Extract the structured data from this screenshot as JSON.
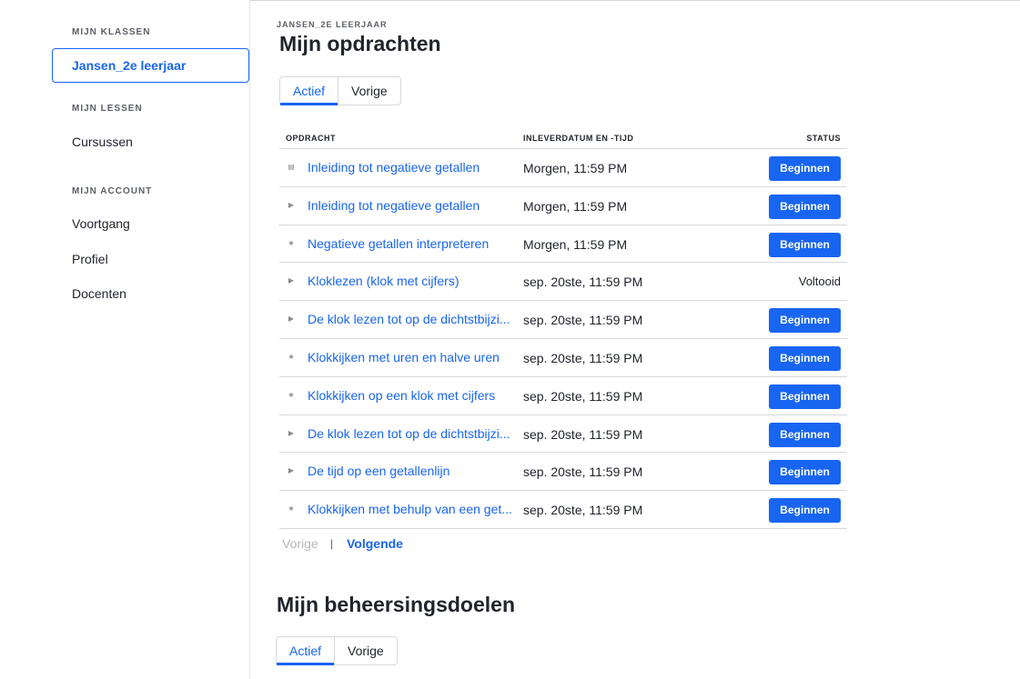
{
  "sidebar": {
    "classes_heading": "MIJN KLASSEN",
    "active_class": "Jansen_2e leerjaar",
    "lessons_heading": "MIJN LESSEN",
    "courses": "Cursussen",
    "account_heading": "MIJN ACCOUNT",
    "progress": "Voortgang",
    "profile": "Profiel",
    "teachers": "Docenten"
  },
  "main": {
    "breadcrumb": "JANSEN_2E LEERJAAR",
    "title": "Mijn opdrachten",
    "tabs": [
      {
        "label": "Actief",
        "active": true
      },
      {
        "label": "Vorige",
        "active": false
      }
    ],
    "columns": {
      "title": "OPDRACHT",
      "date": "INLEVERDATUM EN -TIJD",
      "status": "STATUS"
    },
    "assignments": [
      {
        "icon": "document-icon",
        "title": "Inleiding tot negatieve getallen",
        "date": "Morgen, 11:59 PM",
        "status": "Beginnen"
      },
      {
        "icon": "play-icon",
        "title": "Inleiding tot negatieve getallen",
        "date": "Morgen, 11:59 PM",
        "status": "Beginnen"
      },
      {
        "icon": "star-icon",
        "title": "Negatieve getallen interpreteren",
        "date": "Morgen, 11:59 PM",
        "status": "Beginnen"
      },
      {
        "icon": "play-icon",
        "title": "Kloklezen (klok met cijfers)",
        "date": "sep. 20ste, 11:59 PM",
        "status": "Voltooid"
      },
      {
        "icon": "play-icon",
        "title": "De klok lezen tot op de dichtstbijzi...",
        "date": "sep. 20ste, 11:59 PM",
        "status": "Beginnen"
      },
      {
        "icon": "star-icon",
        "title": "Klokkijken met uren en halve uren",
        "date": "sep. 20ste, 11:59 PM",
        "status": "Beginnen"
      },
      {
        "icon": "star-icon",
        "title": "Klokkijken op een klok met cijfers",
        "date": "sep. 20ste, 11:59 PM",
        "status": "Beginnen"
      },
      {
        "icon": "play-icon",
        "title": "De klok lezen tot op de dichtstbijzi...",
        "date": "sep. 20ste, 11:59 PM",
        "status": "Beginnen"
      },
      {
        "icon": "play-icon",
        "title": "De tijd op een getallenlijn",
        "date": "sep. 20ste, 11:59 PM",
        "status": "Beginnen"
      },
      {
        "icon": "star-icon",
        "title": "Klokkijken met behulp van een get...",
        "date": "sep. 20ste, 11:59 PM",
        "status": "Beginnen"
      }
    ],
    "pager": {
      "prev": "Vorige",
      "separator": "|",
      "next": "Volgende"
    },
    "section2_title": "Mijn beheersingsdoelen",
    "section2_tabs": [
      {
        "label": "Actief",
        "active": true
      },
      {
        "label": "Vorige",
        "active": false
      }
    ]
  },
  "colors": {
    "accent": "#1865f2",
    "text": "#21242c",
    "border": "#d6d8da"
  }
}
